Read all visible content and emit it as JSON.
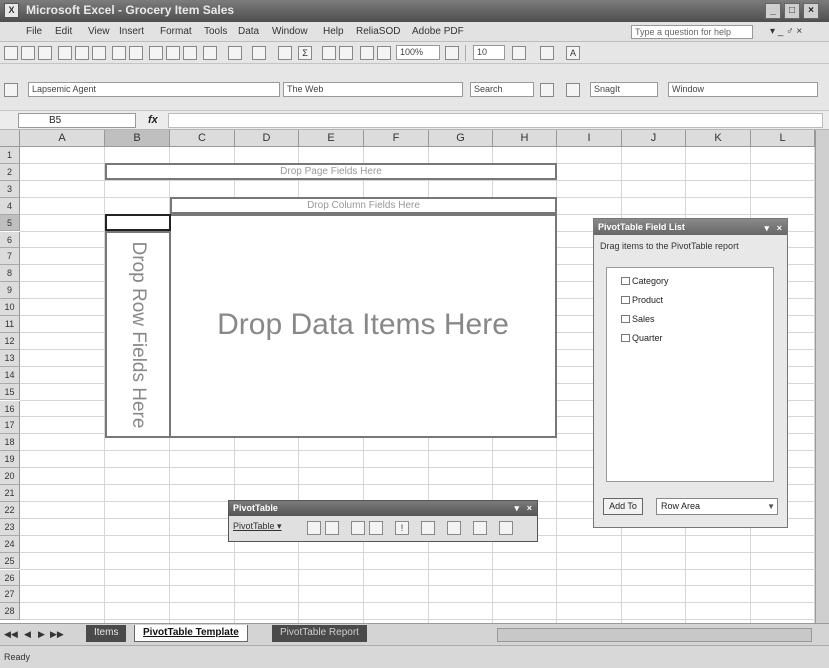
{
  "window": {
    "title": "Microsoft Excel - Grocery Item Sales",
    "app_icon": "excel-icon"
  },
  "menu": {
    "items": [
      "File",
      "Edit",
      "View",
      "Insert",
      "Format",
      "Tools",
      "Data",
      "Window",
      "Help",
      "ReliaSOD",
      "Adobe PDF"
    ],
    "help_placeholder": "Type a question for help"
  },
  "toolbar": {
    "zoom": "100%",
    "font_size": "10",
    "style_field": "Lapsemic Agent",
    "web_field": "The Web",
    "search_label": "Search",
    "snagit_label": "SnagIt",
    "window_label": "Window"
  },
  "formula_bar": {
    "cell_ref": "B5",
    "fx_label": "fx",
    "formula": ""
  },
  "columns": [
    "A",
    "B",
    "C",
    "D",
    "E",
    "F",
    "G",
    "H",
    "I",
    "J",
    "K",
    "L"
  ],
  "rows": [
    "1",
    "2",
    "3",
    "4",
    "5",
    "6",
    "7",
    "8",
    "9",
    "10",
    "11",
    "12",
    "13",
    "14",
    "15",
    "16",
    "17",
    "18",
    "19",
    "20",
    "21",
    "22",
    "23",
    "24",
    "25",
    "26",
    "27",
    "28"
  ],
  "pivot": {
    "drop_page": "Drop Page Fields Here",
    "drop_column": "Drop Column Fields Here",
    "drop_row": "Drop Row Fields Here",
    "drop_data": "Drop Data Items Here"
  },
  "field_list": {
    "title": "PivotTable Field List",
    "description": "Drag items to the PivotTable report",
    "fields": [
      "Category",
      "Product",
      "Sales",
      "Quarter"
    ],
    "add_button": "Add To",
    "area_value": "Row Area"
  },
  "pivot_toolbar": {
    "title": "PivotTable",
    "menu_label": "PivotTable ▾"
  },
  "sheets": {
    "tabs": [
      "Items",
      "PivotTable Template",
      "PivotTable Report"
    ],
    "active": "PivotTable Template"
  },
  "status": {
    "text": "Ready"
  },
  "colors": {
    "title_bar": "#5e5e5e",
    "active_tab": "#ffffff",
    "inactive_tab": "#4a4a4a"
  }
}
